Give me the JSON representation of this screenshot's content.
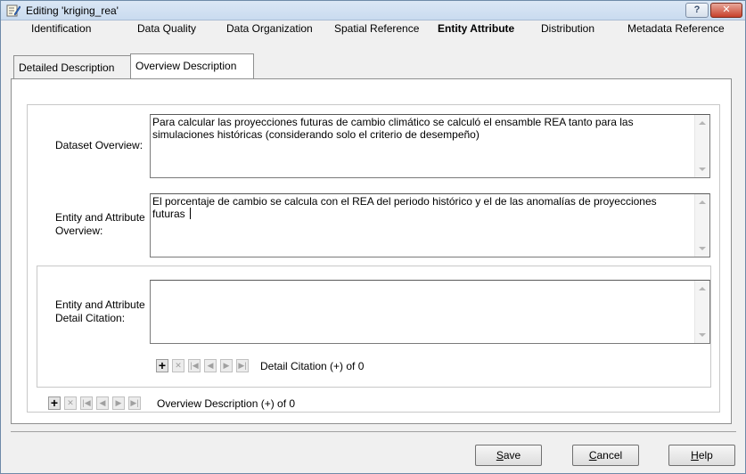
{
  "window": {
    "title": "Editing 'kriging_rea'",
    "help_glyph": "?",
    "close_glyph": "✕"
  },
  "main_tabs": [
    {
      "label": "Identification"
    },
    {
      "label": "Data Quality"
    },
    {
      "label": "Data Organization"
    },
    {
      "label": "Spatial Reference"
    },
    {
      "label": "Entity Attribute",
      "active": true
    },
    {
      "label": "Distribution"
    },
    {
      "label": "Metadata Reference"
    }
  ],
  "sub_tabs": [
    {
      "label": "Detailed Description"
    },
    {
      "label": "Overview Description",
      "active": true
    }
  ],
  "fields": {
    "dataset_overview": {
      "label": "Dataset Overview:",
      "value": "Para calcular las proyecciones futuras de cambio climático se calculó el ensamble REA tanto para las simulaciones históricas (considerando solo el criterio de desempeño)"
    },
    "entity_attribute_overview": {
      "label_line1": "Entity and Attribute",
      "label_line2": "Overview:",
      "value": "El porcentaje de cambio se calcula con el REA del periodo histórico y el de las anomalías de proyecciones futuras "
    },
    "entity_attribute_detail_citation": {
      "label_line1": "Entity and Attribute",
      "label_line2": "Detail Citation:",
      "value": ""
    }
  },
  "detail_citation_nav": {
    "label": "Detail Citation (+) of 0"
  },
  "overview_nav": {
    "label": "Overview Description (+) of 0"
  },
  "nav_glyphs": {
    "add": "+",
    "delete": "✕",
    "first": "|◀",
    "prev": "◀",
    "next": "▶",
    "last": "▶|"
  },
  "buttons": {
    "save": {
      "mnemonic": "S",
      "rest": "ave"
    },
    "cancel": {
      "mnemonic": "C",
      "rest": "ancel"
    },
    "help": {
      "mnemonic": "H",
      "rest": "elp"
    }
  }
}
